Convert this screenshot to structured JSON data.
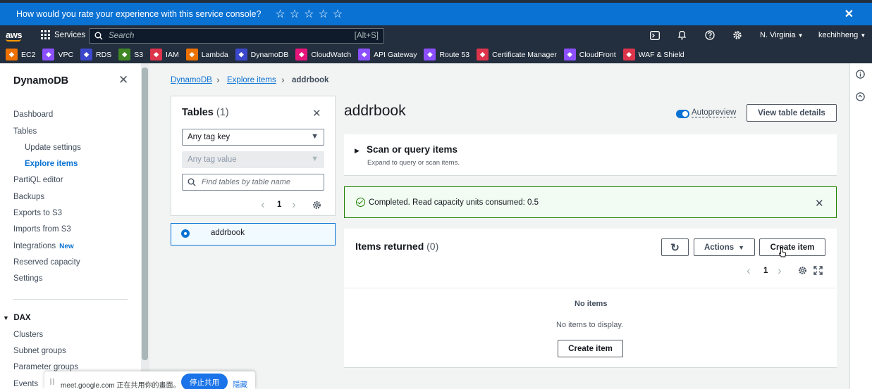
{
  "survey": {
    "question": "How would you rate your experience with this service console?",
    "stars": [
      "☆",
      "☆",
      "☆",
      "☆",
      "☆"
    ],
    "close": "✕"
  },
  "topnav": {
    "logo": "aws",
    "services": "Services",
    "search_placeholder": "Search",
    "search_shortcut": "[Alt+S]",
    "region": "N. Virginia",
    "user": "kechihheng",
    "caret": "▼"
  },
  "favorites": [
    {
      "label": "EC2",
      "color": "#ed7100"
    },
    {
      "label": "VPC",
      "color": "#8c4fff"
    },
    {
      "label": "RDS",
      "color": "#3b48cc"
    },
    {
      "label": "S3",
      "color": "#3f8624"
    },
    {
      "label": "IAM",
      "color": "#dd344c"
    },
    {
      "label": "Lambda",
      "color": "#ed7100"
    },
    {
      "label": "DynamoDB",
      "color": "#3b48cc"
    },
    {
      "label": "CloudWatch",
      "color": "#e7157b"
    },
    {
      "label": "API Gateway",
      "color": "#8c4fff"
    },
    {
      "label": "Route 53",
      "color": "#8c4fff"
    },
    {
      "label": "Certificate Manager",
      "color": "#dd344c"
    },
    {
      "label": "CloudFront",
      "color": "#8c4fff"
    },
    {
      "label": "WAF & Shield",
      "color": "#dd344c"
    }
  ],
  "sidebar": {
    "title": "DynamoDB",
    "close": "✕",
    "items": [
      "Dashboard",
      "Tables",
      "Update settings",
      "Explore items",
      "PartiQL editor",
      "Backups",
      "Exports to S3",
      "Imports from S3",
      "Integrations",
      "Reserved capacity",
      "Settings"
    ],
    "new_badge": "New",
    "dax_caret": "▼",
    "dax_title": "DAX",
    "dax_items": [
      "Clusters",
      "Subnet groups",
      "Parameter groups",
      "Events"
    ]
  },
  "breadcrumb": {
    "items": [
      "DynamoDB",
      "Explore items",
      "addrbook"
    ],
    "sep": "›"
  },
  "tables_panel": {
    "title": "Tables",
    "count": "(1)",
    "close": "✕",
    "tag_key": "Any tag key",
    "tag_value": "Any tag value",
    "find_placeholder": "Find tables by table name",
    "page": "1",
    "prev": "‹",
    "next": "›",
    "table_name": "addrbook"
  },
  "main": {
    "title": "addrbook",
    "autopreview": "Autopreview",
    "autopreview_on": true,
    "view_details": "View table details",
    "scan_caret": "▶",
    "scan_title": "Scan or query items",
    "scan_desc": "Expand to query or scan items.",
    "flash_text": "Completed. Read capacity units consumed: 0.5",
    "flash_close": "✕",
    "items_title": "Items returned",
    "items_count": "(0)",
    "refresh": "↻",
    "actions": "Actions",
    "create_item": "Create item",
    "page": "1",
    "prev": "‹",
    "next": "›",
    "no_items": "No items",
    "no_items_desc": "No items to display.",
    "create_item_empty": "Create item"
  },
  "share_bar": {
    "text": "meet.google.com 正在共用你的畫面。",
    "stop": "停止共用",
    "hide": "隱藏"
  },
  "colors": {
    "accent": "#0972d3",
    "nav_bg": "#232f3e",
    "success": "#1d8102"
  }
}
